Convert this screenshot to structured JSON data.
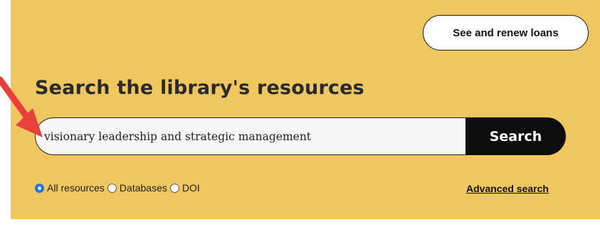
{
  "header": {
    "loans_button_label": "See and renew loans"
  },
  "search": {
    "heading": "Search the library's resources",
    "input_value": "visionary leadership and strategic management",
    "button_label": "Search"
  },
  "scope_options": {
    "selected": "All resources",
    "items": [
      "All resources",
      "Databases",
      "DOI"
    ]
  },
  "advanced_search_label": "Advanced search",
  "colors": {
    "panel_background": "#f0c75e",
    "search_button": "#0d0d0d",
    "annotation_arrow": "#e8403a",
    "radio_selected": "#1a73e8"
  }
}
